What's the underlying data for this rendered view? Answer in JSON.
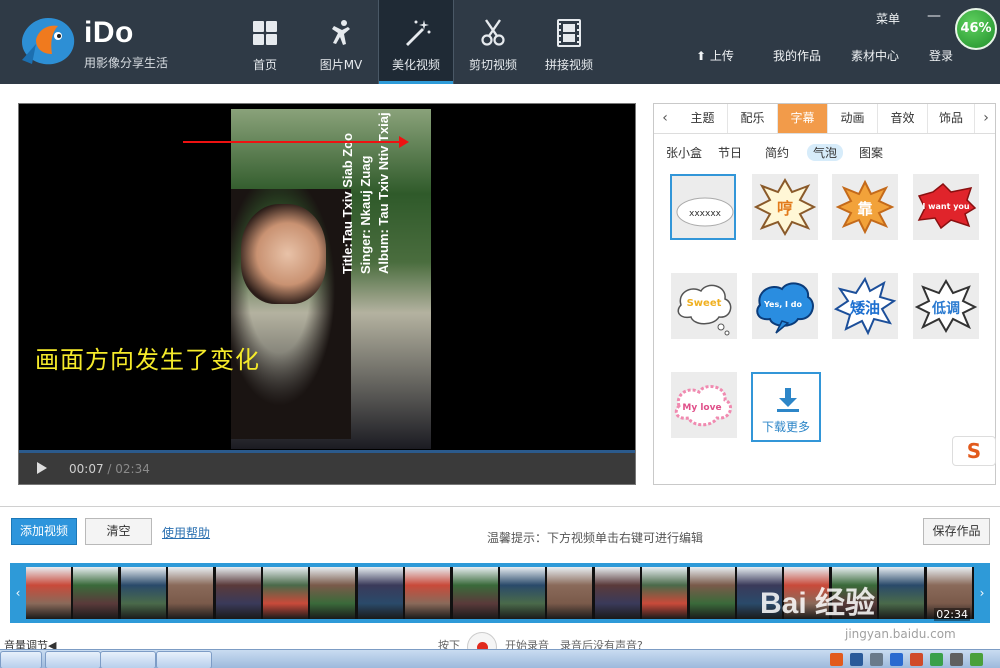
{
  "app": {
    "brand": "iDo",
    "slogan": "用影像分享生活",
    "perf": "46%"
  },
  "nav": [
    {
      "label": "首页",
      "icon": "home-icon"
    },
    {
      "label": "图片MV",
      "icon": "dance-icon"
    },
    {
      "label": "美化视频",
      "icon": "magic-wand-icon",
      "active": true
    },
    {
      "label": "剪切视频",
      "icon": "scissors-icon"
    },
    {
      "label": "拼接视频",
      "icon": "film-icon"
    }
  ],
  "top_right": {
    "menu": "菜单",
    "minimize": "—",
    "upload": "上传",
    "my_works": "我的作品",
    "materials": "素材中心",
    "login": "登录"
  },
  "player": {
    "caption": "画面方向发生了变化",
    "current_time": "00:07",
    "duration": "/ 02:34",
    "frame_text": "Title:Tau Txiv Siab Zoo\nSinger: Nkauj Zuag\nAlbum: Tau Txiv Ntiv Txiaj"
  },
  "panel": {
    "tabs": [
      "主题",
      "配乐",
      "字幕",
      "动画",
      "音效",
      "饰品"
    ],
    "active_tab": "字幕",
    "subtabs": [
      "张小盒",
      "节日",
      "简约",
      "气泡",
      "图案"
    ],
    "active_subtab": "气泡",
    "items": [
      {
        "text": "xxxxxx",
        "style": "cloud",
        "selected": true
      },
      {
        "text": "哼",
        "style": "burst-yellow"
      },
      {
        "text": "靠",
        "style": "burst-orange"
      },
      {
        "text": "I want you",
        "style": "burst-red"
      },
      {
        "text": "Sweet",
        "style": "cloud-yellow"
      },
      {
        "text": "Yes, I do",
        "style": "cloud-blue"
      },
      {
        "text": "矮油",
        "style": "burst-blue"
      },
      {
        "text": "低调",
        "style": "burst-white"
      },
      {
        "text": "My love",
        "style": "cloud-pink"
      }
    ],
    "download_more": "下载更多"
  },
  "toolbar": {
    "add_video": "添加视频",
    "clear": "清空",
    "help": "使用帮助",
    "hint": "温馨提示：下方视频单击右键可进行编辑",
    "save": "保存作品"
  },
  "timeline": {
    "time": "02:34"
  },
  "footer": {
    "volume": "音量调节",
    "press": "按下",
    "record": "开始录音",
    "record_help": "录音后没有声音?"
  },
  "watermark": {
    "text": "Bai 经验",
    "url": "jingyan.baidu.com"
  }
}
